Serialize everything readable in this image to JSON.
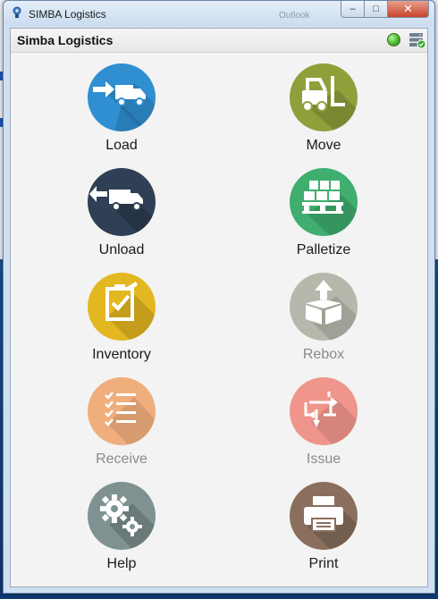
{
  "window": {
    "title": "SIMBA Logistics",
    "background_text": "Outlook",
    "buttons": {
      "minimize": "–",
      "maximize": "□",
      "close": "✕"
    }
  },
  "header": {
    "title": "Simba Logistics",
    "status_color": "#47b82e"
  },
  "tiles": [
    {
      "label": "Load",
      "color": "#2f8fd0",
      "icon": "truck-loading-icon",
      "enabled": true
    },
    {
      "label": "Move",
      "color": "#8ea03a",
      "icon": "forklift-icon",
      "enabled": true
    },
    {
      "label": "Unload",
      "color": "#2f3f55",
      "icon": "truck-unloading-icon",
      "enabled": true
    },
    {
      "label": "Palletize",
      "color": "#3fae6e",
      "icon": "pallet-boxes-icon",
      "enabled": true
    },
    {
      "label": "Inventory",
      "color": "#e3b720",
      "icon": "clipboard-check-icon",
      "enabled": true
    },
    {
      "label": "Rebox",
      "color": "#b7b7ac",
      "icon": "open-box-icon",
      "enabled": false
    },
    {
      "label": "Receive",
      "color": "#efae7c",
      "icon": "checklist-icon",
      "enabled": false
    },
    {
      "label": "Issue",
      "color": "#ef958b",
      "icon": "exchange-arrows-icon",
      "enabled": false
    },
    {
      "label": "Help",
      "color": "#7f9291",
      "icon": "gears-icon",
      "enabled": true
    },
    {
      "label": "Print",
      "color": "#8a6f5e",
      "icon": "printer-icon",
      "enabled": true
    }
  ]
}
